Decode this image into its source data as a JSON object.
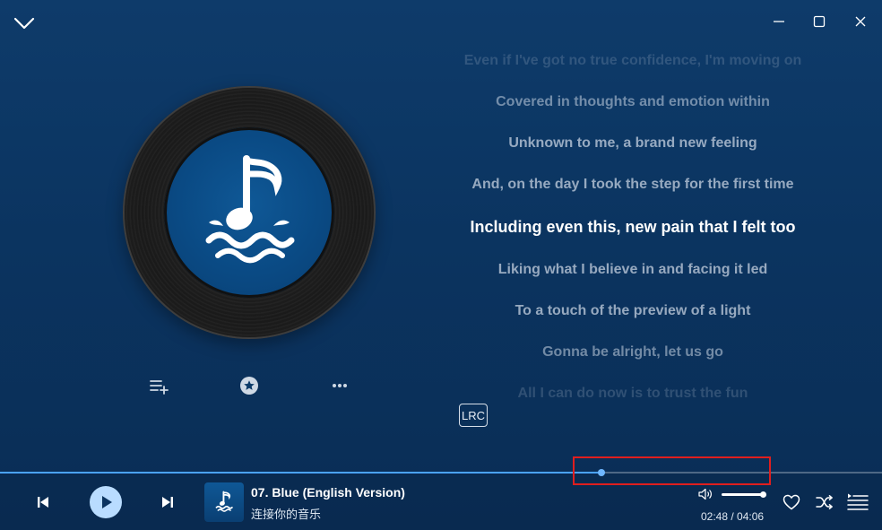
{
  "window": {
    "collapse_icon": "chevron-down-icon",
    "minimize_icon": "minimize-icon",
    "maximize_icon": "maximize-icon",
    "close_icon": "close-icon"
  },
  "album_art": {
    "icon": "music-note-wave-icon"
  },
  "actions": {
    "add_to_playlist_icon": "playlist-add-icon",
    "favorite_star_icon": "star-icon",
    "more_icon": "more-icon"
  },
  "lyrics": {
    "lines": [
      "Even if I've got no true confidence, I'm moving on",
      "Covered in thoughts and emotion within",
      "Unknown to me, a brand new feeling",
      "And, on the day I took the step for the first time",
      "Including even this, new pain that I felt too",
      "Liking what I believe in and facing it led",
      "To a touch of the preview of a light",
      "Gonna be alright, let us go",
      "All I can do now is to trust the fun"
    ],
    "active_index": 4
  },
  "lrc_button": {
    "label": "LRC"
  },
  "playback": {
    "progress_fraction": 0.682,
    "current_time": "02:48",
    "duration": "04:06",
    "time_separator": " / "
  },
  "track": {
    "title": "07. Blue (English Version)",
    "artist": "连接你的音乐"
  },
  "volume": {
    "level_fraction": 1.0,
    "icon": "volume-icon"
  },
  "controls": {
    "previous_icon": "skip-previous-icon",
    "play_icon": "play-icon",
    "next_icon": "skip-next-icon",
    "like_icon": "heart-icon",
    "shuffle_icon": "shuffle-icon",
    "queue_icon": "queue-icon"
  },
  "colors": {
    "background": "#0b3460",
    "accent": "#4aa3ff",
    "play_button": "#b9dcff",
    "highlight_box": "#e01e1e"
  }
}
